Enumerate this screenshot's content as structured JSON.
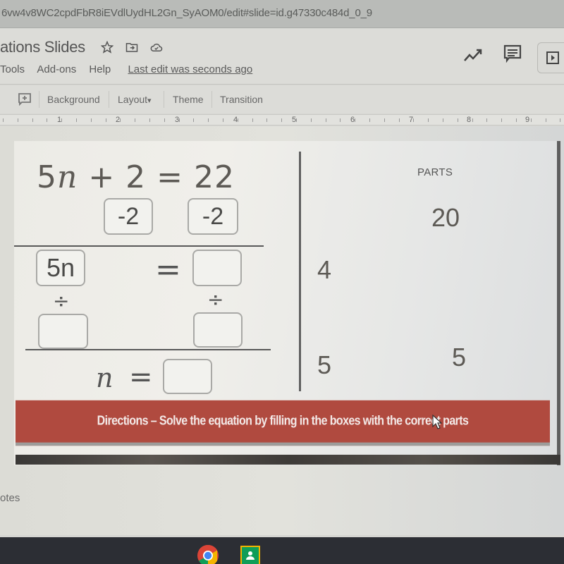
{
  "browser": {
    "url": "6vw4v8WC2cpdFbR8iEVdlUydHL2Gn_SyAOM0/edit#slide=id.g47330c484d_0_9"
  },
  "app": {
    "doc_title": "ations Slides",
    "title_icons": [
      "star-icon",
      "move-to-folder-icon",
      "cloud-saved-icon"
    ],
    "menu_items": [
      "Tools",
      "Add-ons",
      "Help"
    ],
    "last_edit": "Last edit was seconds ago",
    "top_right_icons": [
      "activity-trend-icon",
      "comments-icon",
      "present-icon"
    ]
  },
  "toolbar": {
    "new_comment_icon": "add-comment-icon",
    "background_label": "Background",
    "layout_label": "Layout",
    "layout_caret": "▾",
    "theme_label": "Theme",
    "transition_label": "Transition"
  },
  "ruler": {
    "labels": [
      "1",
      "2",
      "3",
      "4",
      "5",
      "6",
      "7",
      "8",
      "9"
    ]
  },
  "slide": {
    "equation": {
      "coef": "5",
      "variable": "n",
      "rest": " + 2 = 22"
    },
    "step1": {
      "left_box": "-2",
      "right_box": "-2"
    },
    "step2": {
      "left_box": "5n",
      "equals": "=",
      "right_box": "",
      "divide_left": "÷",
      "divide_right": "÷",
      "left_divisor_box": "",
      "right_divisor_box": ""
    },
    "result": {
      "variable": "n",
      "equals": "=",
      "answer_box": ""
    },
    "parts": {
      "label": "PARTS",
      "items": [
        "20",
        "4",
        "5",
        "5"
      ]
    },
    "directions": "Directions – Solve the equation by filling in the boxes with the correct parts"
  },
  "notes": {
    "label": "otes"
  },
  "shelf": {
    "apps": [
      "chrome-icon",
      "google-classroom-icon"
    ]
  }
}
